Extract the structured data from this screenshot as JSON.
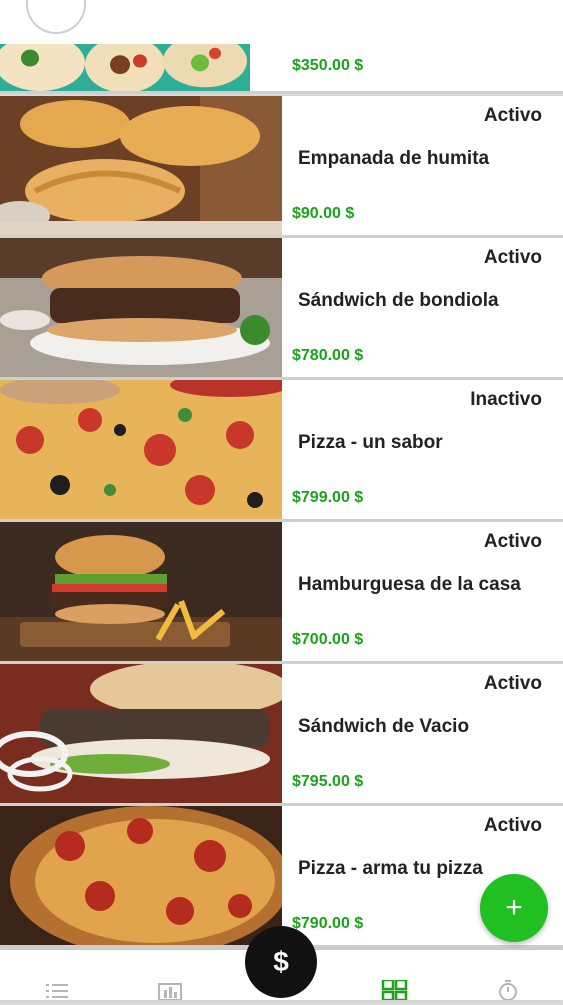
{
  "products": [
    {
      "name": "",
      "status": "",
      "price": "$350.00 $",
      "image": "wrap-image"
    },
    {
      "name": "Empanada de humita",
      "status": "Activo",
      "price": "$90.00 $",
      "image": "empanada-image"
    },
    {
      "name": "Sándwich de bondiola",
      "status": "Activo",
      "price": "$780.00 $",
      "image": "bondiola-sandwich-image"
    },
    {
      "name": "Pizza - un sabor",
      "status": "Inactivo",
      "price": "$799.00 $",
      "image": "pizza-image"
    },
    {
      "name": "Hamburguesa de la casa",
      "status": "Activo",
      "price": "$700.00 $",
      "image": "burger-image"
    },
    {
      "name": "Sándwich de Vacio",
      "status": "Activo",
      "price": "$795.00 $",
      "image": "vacio-sandwich-image"
    },
    {
      "name": "Pizza - arma tu pizza",
      "status": "Activo",
      "price": "$790.00 $",
      "image": "pepperoni-pizza-image"
    }
  ],
  "fab": {
    "label": "+",
    "icon": "plus-icon"
  },
  "center_button": {
    "label": "$",
    "icon": "dollar-icon"
  },
  "bottom_nav": [
    "list-icon",
    "chart-icon",
    "grid-icon",
    "stopwatch-icon"
  ],
  "colors": {
    "price": "#1aa41a",
    "fab": "#1fc01f",
    "center_button": "#111111",
    "active_nav": "#1aa41a"
  }
}
